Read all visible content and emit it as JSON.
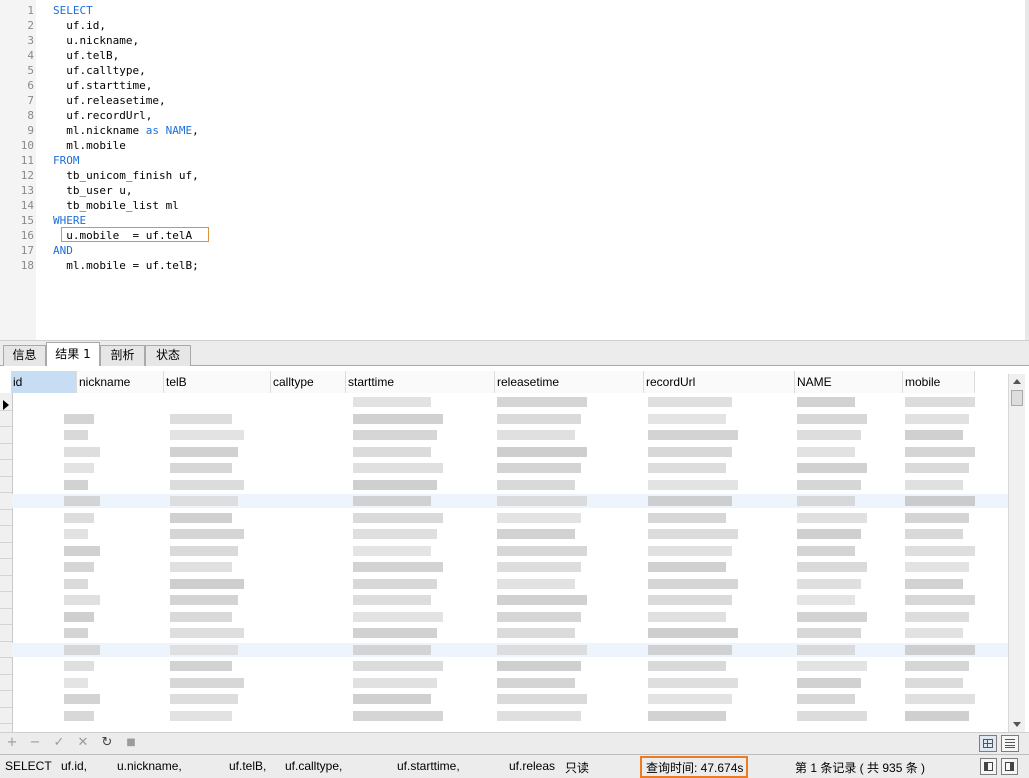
{
  "editor": {
    "lines": [
      {
        "num": "1",
        "parts": [
          {
            "t": "SELECT",
            "kw": true
          }
        ]
      },
      {
        "num": "2",
        "parts": [
          {
            "t": "  uf.id,"
          }
        ]
      },
      {
        "num": "3",
        "parts": [
          {
            "t": "  u.nickname,"
          }
        ]
      },
      {
        "num": "4",
        "parts": [
          {
            "t": "  uf.telB,"
          }
        ]
      },
      {
        "num": "5",
        "parts": [
          {
            "t": "  uf.calltype,"
          }
        ]
      },
      {
        "num": "6",
        "parts": [
          {
            "t": "  uf.starttime,"
          }
        ]
      },
      {
        "num": "7",
        "parts": [
          {
            "t": "  uf.releasetime,"
          }
        ]
      },
      {
        "num": "8",
        "parts": [
          {
            "t": "  uf.recordUrl,"
          }
        ]
      },
      {
        "num": "9",
        "parts": [
          {
            "t": "  ml.nickname "
          },
          {
            "t": "as NAME",
            "kw": true
          },
          {
            "t": ","
          }
        ]
      },
      {
        "num": "10",
        "parts": [
          {
            "t": "  ml.mobile"
          }
        ]
      },
      {
        "num": "11",
        "parts": [
          {
            "t": "FROM",
            "kw": true
          }
        ]
      },
      {
        "num": "12",
        "parts": [
          {
            "t": "  tb_unicom_finish uf,"
          }
        ]
      },
      {
        "num": "13",
        "parts": [
          {
            "t": "  tb_user u,"
          }
        ]
      },
      {
        "num": "14",
        "parts": [
          {
            "t": "  tb_mobile_list ml"
          }
        ]
      },
      {
        "num": "15",
        "parts": [
          {
            "t": "WHERE",
            "kw": true
          }
        ]
      },
      {
        "num": "16",
        "parts": [
          {
            "t": "  u.mobile  = uf.telA"
          }
        ]
      },
      {
        "num": "17",
        "parts": [
          {
            "t": "AND",
            "kw": true
          }
        ]
      },
      {
        "num": "18",
        "parts": [
          {
            "t": "  ml.mobile = uf.telB;"
          }
        ]
      }
    ]
  },
  "tabs": [
    {
      "label": "信息",
      "active": false
    },
    {
      "label": "结果 1",
      "active": true
    },
    {
      "label": "剖析",
      "active": false
    },
    {
      "label": "状态",
      "active": false
    }
  ],
  "grid": {
    "columns": [
      "id",
      "nickname",
      "telB",
      "calltype",
      "starttime",
      "releasetime",
      "recordUrl",
      "NAME",
      "mobile"
    ]
  },
  "toolbar": {
    "add": "+",
    "remove": "−",
    "apply": "✓",
    "discard": "✕",
    "refresh": "↻",
    "stop": "■"
  },
  "status": {
    "query": "SELECT",
    "q1": "uf.id,",
    "q2": "u.nickname,",
    "q3": "uf.telB,",
    "q4": "uf.calltype,",
    "q5": "uf.starttime,",
    "q6": "uf.releas",
    "readonly": "只读",
    "query_time": "查询时间: 47.674s",
    "records": "第 1 条记录 ( 共 935 条 )"
  },
  "colors": {
    "keyword": "#1c6fd8",
    "highlight_border": "#d8953a",
    "query_time_border": "#ec7b22"
  }
}
